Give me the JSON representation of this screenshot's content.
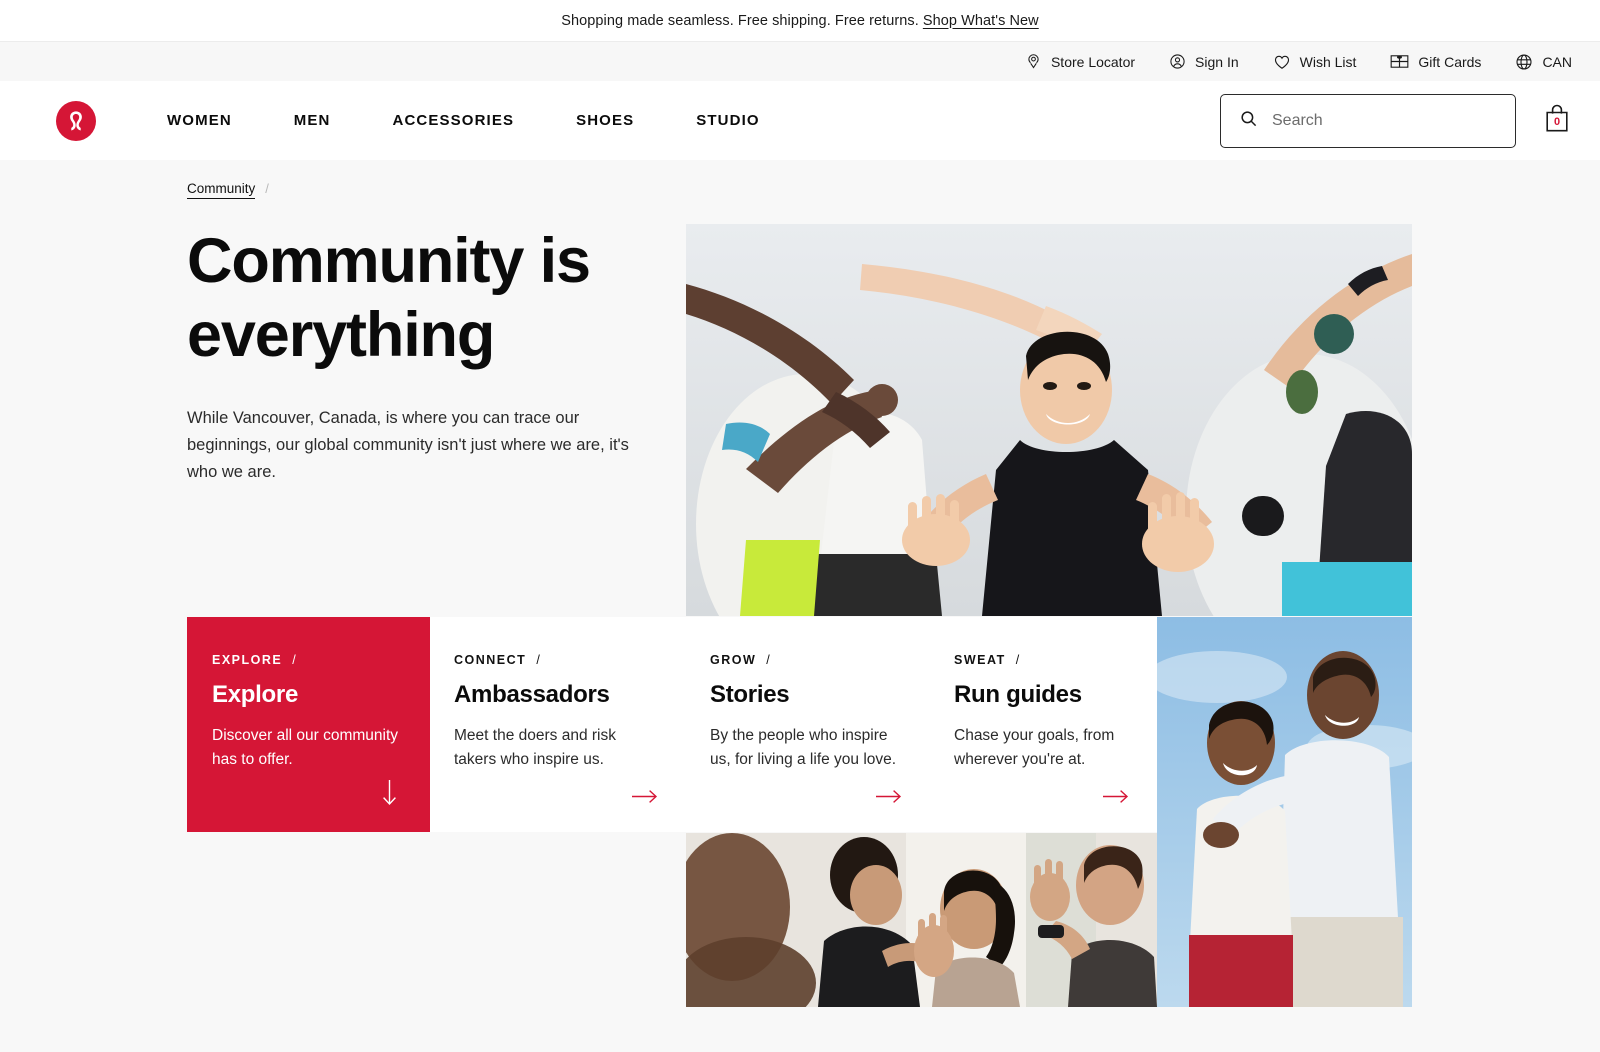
{
  "promo": {
    "text": "Shopping made seamless. Free shipping. Free returns.",
    "link_label": "Shop What's New"
  },
  "utility_nav": {
    "items": [
      {
        "label": "Store Locator",
        "icon": "location-pin-icon"
      },
      {
        "label": "Sign In",
        "icon": "user-circle-icon"
      },
      {
        "label": "Wish List",
        "icon": "heart-icon"
      },
      {
        "label": "Gift Cards",
        "icon": "gift-card-icon"
      },
      {
        "label": "CAN",
        "icon": "globe-icon"
      }
    ]
  },
  "header": {
    "logo_alt": "lululemon-logo",
    "nav": [
      {
        "label": "WOMEN"
      },
      {
        "label": "MEN"
      },
      {
        "label": "ACCESSORIES"
      },
      {
        "label": "SHOES"
      },
      {
        "label": "STUDIO"
      }
    ],
    "search": {
      "value": "",
      "placeholder": "Search",
      "icon": "search-icon"
    },
    "cart": {
      "count": "0",
      "icon": "shopping-bag-icon"
    }
  },
  "breadcrumb": {
    "items": [
      {
        "label": "Community"
      }
    ],
    "separator": "/"
  },
  "hero": {
    "title_line1": "Community is",
    "title_line2": "everything",
    "body": "While Vancouver, Canada, is where you can trace our beginnings, our global community isn't just where we are, it's who we are.",
    "image_alt": "runner-high-fiving-tunnel-of-hands"
  },
  "cards": [
    {
      "eyebrow": "EXPLORE",
      "slash": "/",
      "title": "Explore",
      "desc": "Discover all our community has to offer.",
      "arrow": "↓",
      "arrow_icon": "arrow-down-icon",
      "variant": "explore"
    },
    {
      "eyebrow": "CONNECT",
      "slash": "/",
      "title": "Ambassadors",
      "desc": "Meet the doers and risk takers who inspire us.",
      "arrow": "→",
      "arrow_icon": "arrow-right-icon",
      "variant": "connect"
    },
    {
      "eyebrow": "GROW",
      "slash": "/",
      "title": "Stories",
      "desc": "By the people who inspire us, for living a life you love.",
      "arrow": "→",
      "arrow_icon": "arrow-right-icon",
      "variant": "grow"
    },
    {
      "eyebrow": "SWEAT",
      "slash": "/",
      "title": "Run guides",
      "desc": "Chase your goals, from wherever you're at.",
      "arrow": "→",
      "arrow_icon": "arrow-right-icon",
      "variant": "sweat"
    }
  ],
  "media": {
    "couple_image_alt": "smiling-couple-outdoors",
    "yoga_image_alt": "yoga-class-practicing"
  },
  "colors": {
    "brand_red": "#d51636",
    "page_background": "#f8f8f8",
    "text_primary": "#0b0b0b"
  }
}
